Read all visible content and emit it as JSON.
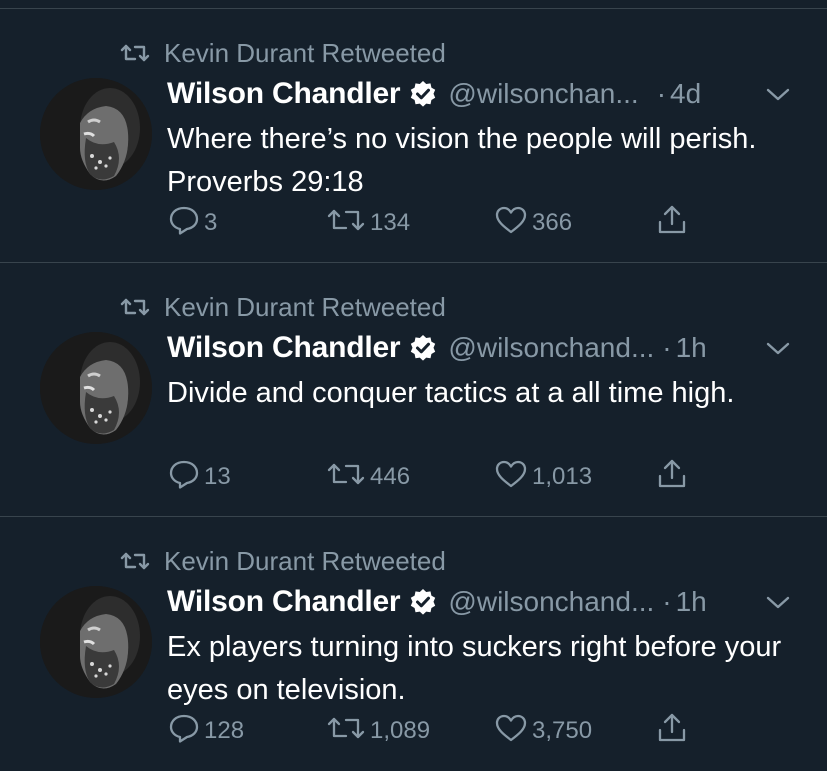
{
  "colors": {
    "background": "#15202b",
    "divider": "#38444d",
    "secondary_text": "#8899a6",
    "primary_text": "#ffffff"
  },
  "tweets": [
    {
      "retweeted_by": "Kevin Durant Retweeted",
      "name": "Wilson Chandler",
      "handle": "@wilsonchan...",
      "separator": "·",
      "time": "4d",
      "text": "Where there’s no vision the people will perish. Proverbs 29:18",
      "replies": "3",
      "retweets": "134",
      "likes": "366",
      "icons": [
        "retweet-icon",
        "verified-badge-icon",
        "chevron-down-icon",
        "reply-icon",
        "retweet-icon",
        "like-icon",
        "share-icon"
      ]
    },
    {
      "retweeted_by": "Kevin Durant Retweeted",
      "name": "Wilson Chandler",
      "handle": "@wilsonchand...",
      "separator": "·",
      "time": "1h",
      "text": "Divide and conquer tactics at a all time high.",
      "replies": "13",
      "retweets": "446",
      "likes": "1,013",
      "icons": [
        "retweet-icon",
        "verified-badge-icon",
        "chevron-down-icon",
        "reply-icon",
        "retweet-icon",
        "like-icon",
        "share-icon"
      ]
    },
    {
      "retweeted_by": "Kevin Durant Retweeted",
      "name": "Wilson Chandler",
      "handle": "@wilsonchand...",
      "separator": "·",
      "time": "1h",
      "text": "Ex players turning into suckers right before your eyes on television.",
      "replies": "128",
      "retweets": "1,089",
      "likes": "3,750",
      "icons": [
        "retweet-icon",
        "verified-badge-icon",
        "chevron-down-icon",
        "reply-icon",
        "retweet-icon",
        "like-icon",
        "share-icon"
      ]
    }
  ]
}
